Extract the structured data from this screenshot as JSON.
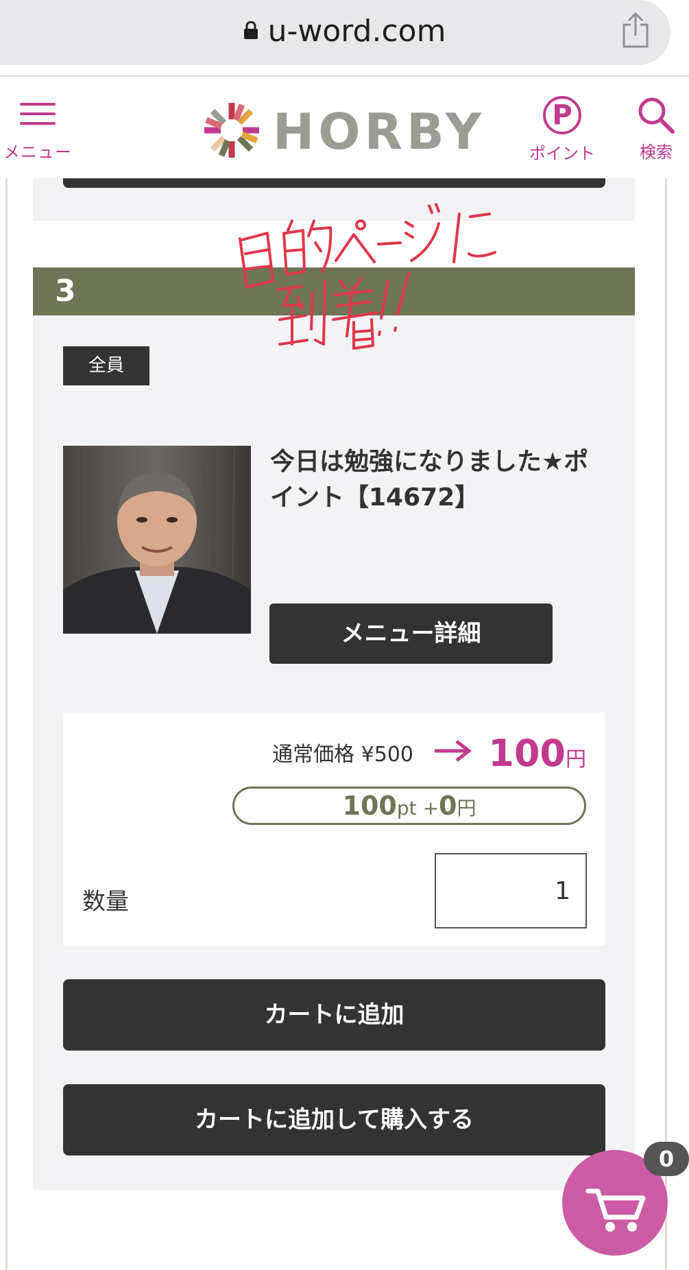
{
  "browser": {
    "url": "u-word.com"
  },
  "header": {
    "menu_label": "メニュー",
    "logo_text": "HORBY",
    "point_symbol": "P",
    "point_label": "ポイント",
    "search_label": "検索"
  },
  "item": {
    "number": "3",
    "badge": "全員",
    "title": "今日は勉強になりました★ポイント【14672】",
    "detail_button": "メニュー詳細",
    "normal_price": "通常価格 ¥500",
    "sale_price": "100",
    "sale_currency": "円",
    "points_amount": "100",
    "points_unit": "pt +",
    "points_cash": "0",
    "points_currency": "円",
    "quantity_label": "数量",
    "quantity_value": "1",
    "add_to_cart": "カートに追加",
    "add_and_buy": "カートに追加して購入する"
  },
  "annotation": {
    "line1": "目的ページに",
    "line2": "到着!!"
  },
  "cart": {
    "count": "0"
  },
  "colors": {
    "accent": "#c23a8e",
    "header_band": "#6e7556",
    "button_dark": "#333333",
    "card_bg": "#f3f3f5",
    "fab": "#cc5ba6",
    "handwriting": "#e0374a"
  },
  "icons": [
    "lock-icon",
    "share-icon",
    "hamburger-icon",
    "logo-mark-icon",
    "point-icon",
    "search-icon",
    "arrow-right-icon",
    "cart-icon"
  ]
}
